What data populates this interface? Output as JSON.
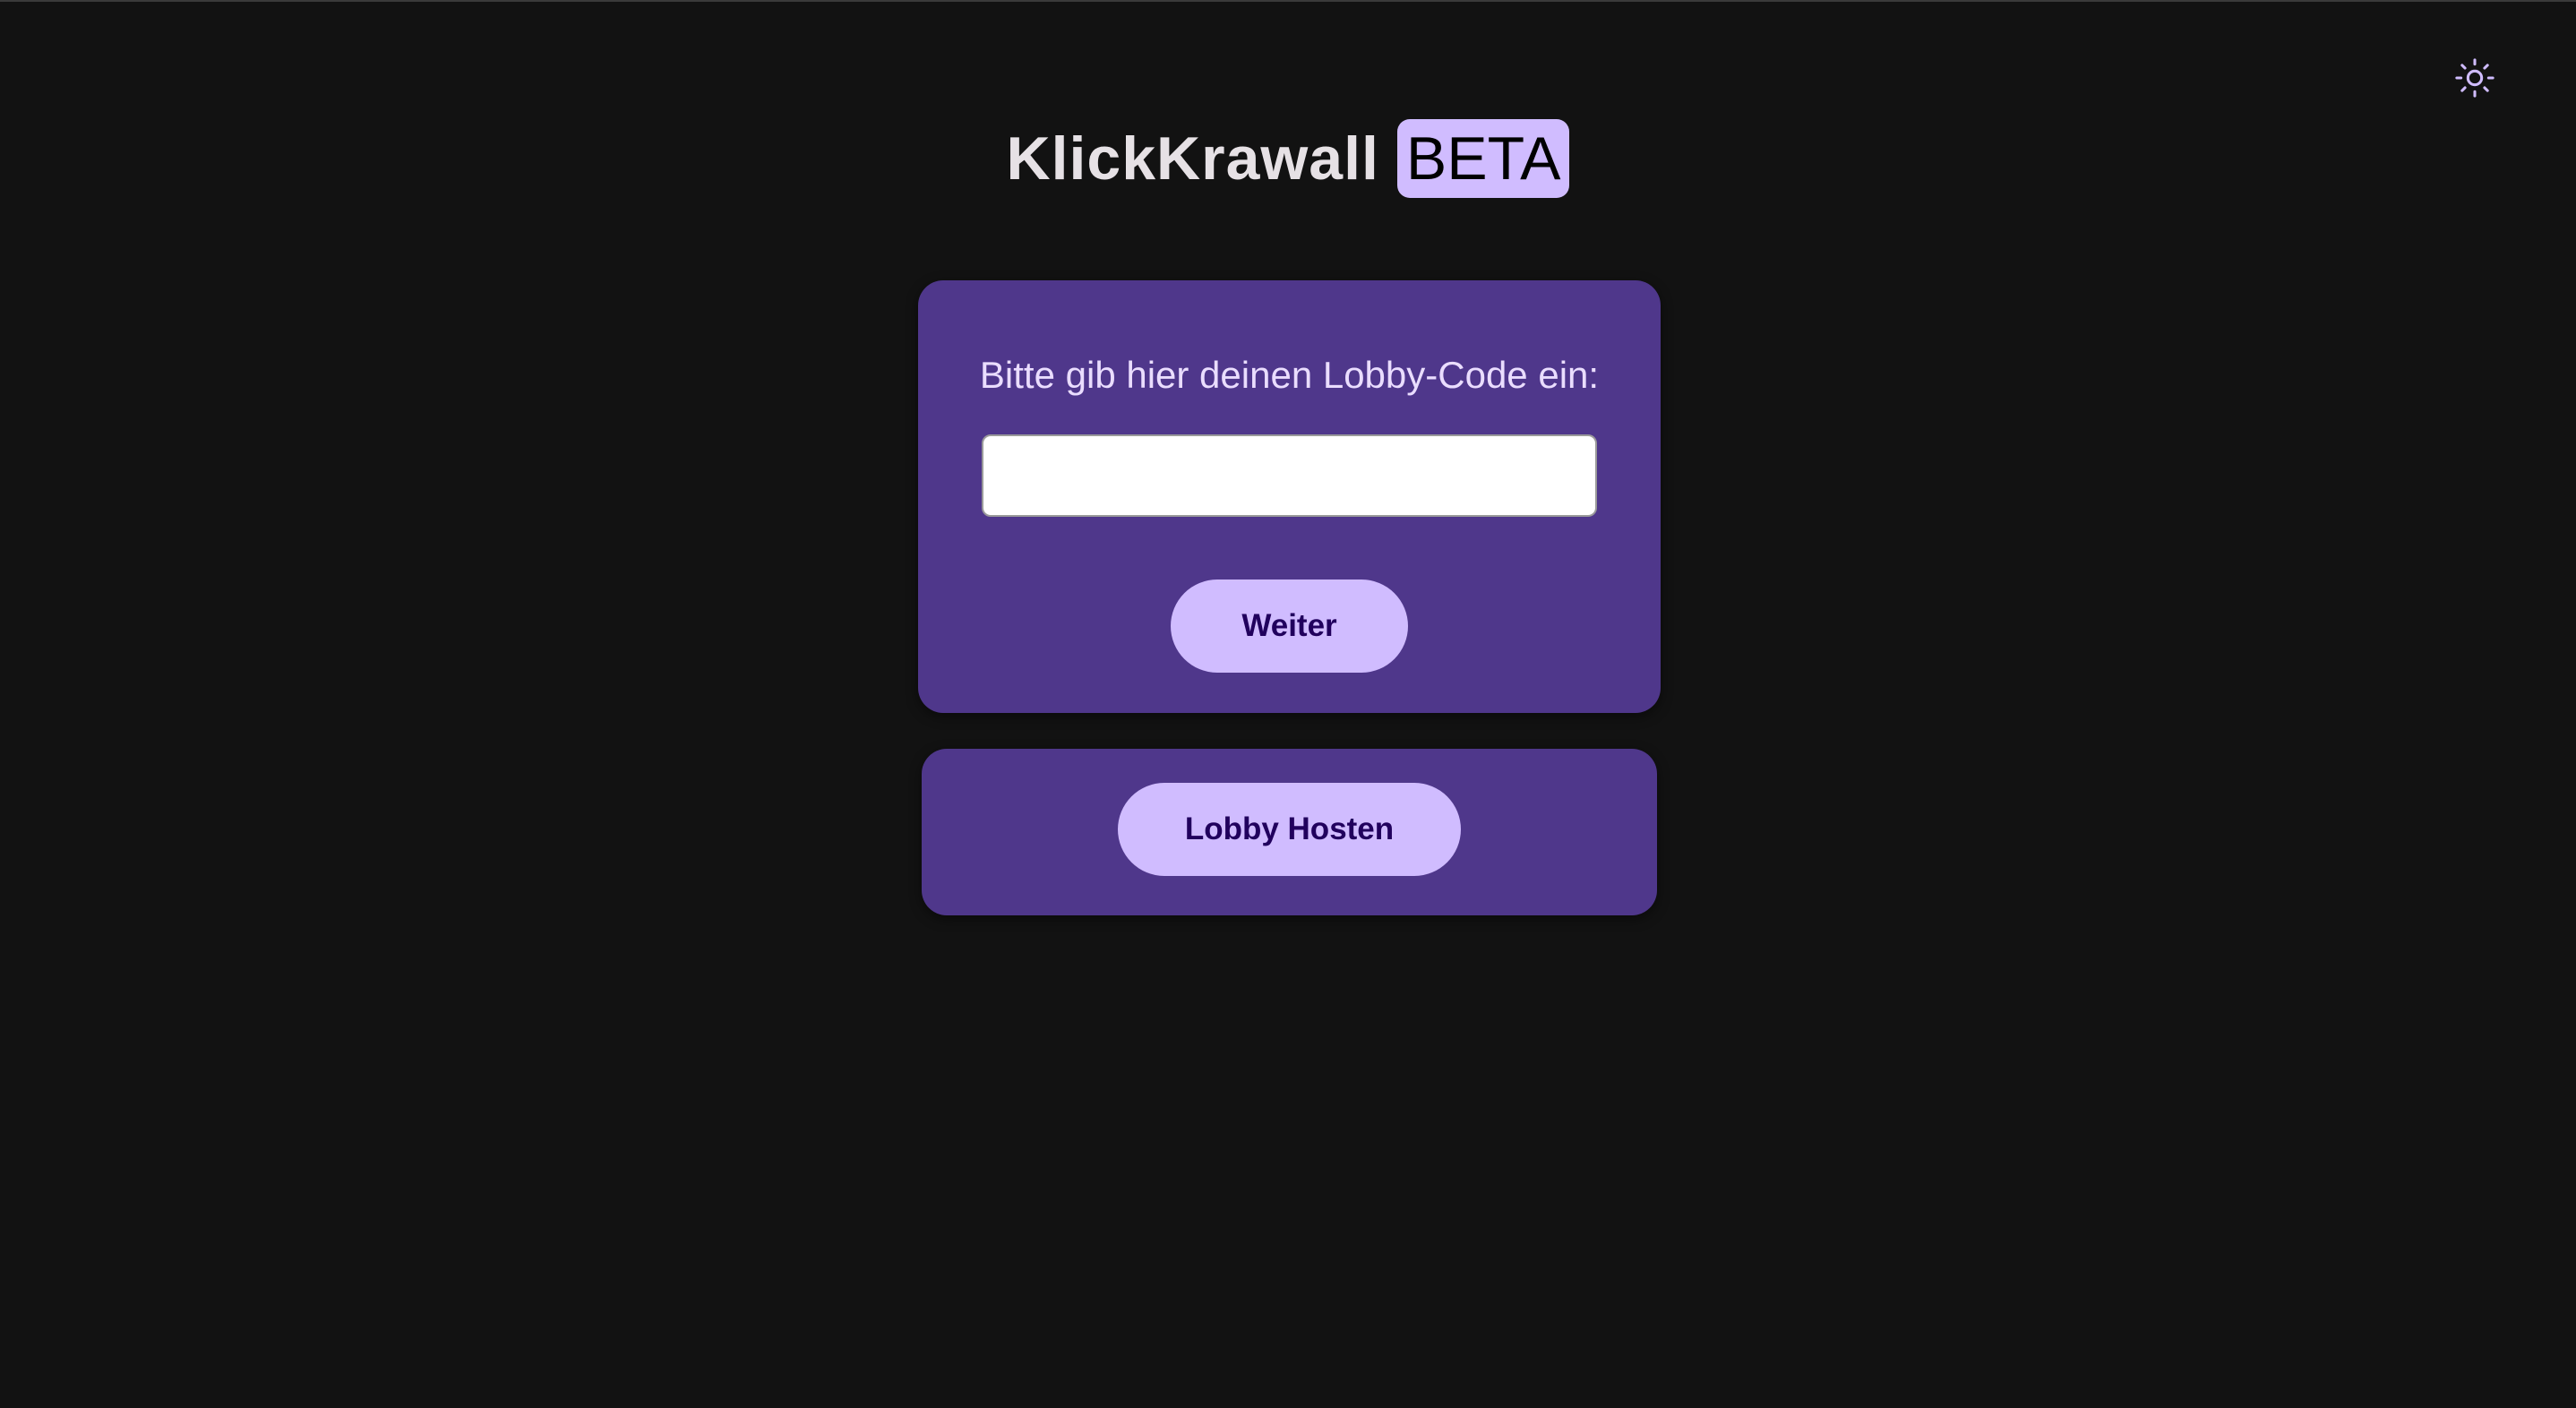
{
  "header": {
    "title": "KlickKrawall",
    "badge": "BETA",
    "theme_toggle_icon": "sun-icon"
  },
  "join_card": {
    "prompt": "Bitte gib hier deinen Lobby-Code ein:",
    "code_input": {
      "value": "",
      "placeholder": ""
    },
    "continue_label": "Weiter"
  },
  "host_card": {
    "host_label": "Lobby Hosten"
  },
  "colors": {
    "background": "#121212",
    "card": "#4f378b",
    "accent": "#d0bcff",
    "button_text": "#21005d"
  }
}
